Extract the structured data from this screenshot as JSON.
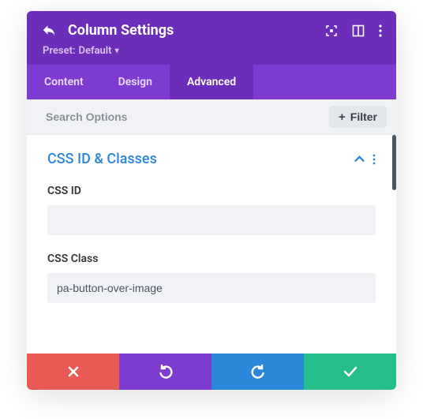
{
  "header": {
    "title": "Column Settings",
    "preset_prefix": "Preset: ",
    "preset_value": "Default"
  },
  "tabs": [
    {
      "label": "Content",
      "active": false
    },
    {
      "label": "Design",
      "active": false
    },
    {
      "label": "Advanced",
      "active": true
    }
  ],
  "search": {
    "placeholder": "Search Options",
    "filter_label": "Filter"
  },
  "section": {
    "title": "CSS ID & Classes",
    "expanded": true,
    "fields": {
      "css_id": {
        "label": "CSS ID",
        "value": ""
      },
      "css_class": {
        "label": "CSS Class",
        "value": "pa-button-over-image"
      }
    }
  },
  "icons": {
    "back": "back-arrow-icon",
    "focus": "focus-icon",
    "layout": "layout-icon",
    "kebab": "kebab-icon",
    "collapse": "chevron-up-icon",
    "plus": "plus-icon",
    "cancel": "close-icon",
    "undo": "undo-icon",
    "redo": "redo-icon",
    "save": "check-icon"
  }
}
